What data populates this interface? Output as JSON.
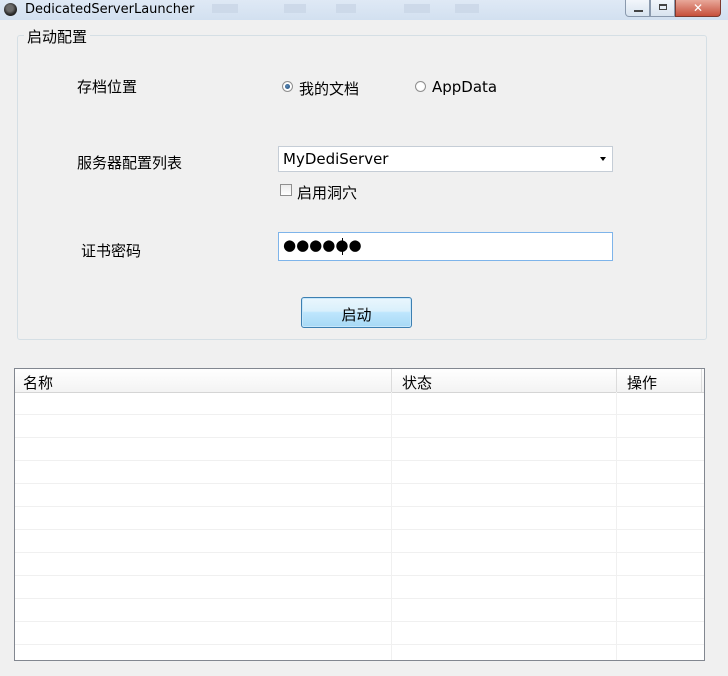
{
  "window": {
    "title": "DedicatedServerLauncher",
    "minimize_glyph": "",
    "maximize_glyph": "",
    "close_glyph": "✕"
  },
  "launch_config": {
    "group_title": "启动配置",
    "save_location": {
      "label": "存档位置",
      "options": [
        {
          "label": "我的文档",
          "selected": true
        },
        {
          "label": "AppData",
          "selected": false
        }
      ]
    },
    "server_config_list": {
      "label": "服务器配置列表",
      "selected_value": "MyDediServer"
    },
    "enable_caves": {
      "label": "启用洞穴",
      "checked": false
    },
    "certificate_password": {
      "label": "证书密码",
      "masked_value": "●●●●●●"
    },
    "start_button_label": "启动"
  },
  "table": {
    "columns": [
      "名称",
      "状态",
      "操作"
    ],
    "rows": []
  },
  "colors": {
    "window_bg": "#f0f0f0",
    "accent_border": "#3c7fb1",
    "close_button": "#c7503b"
  }
}
